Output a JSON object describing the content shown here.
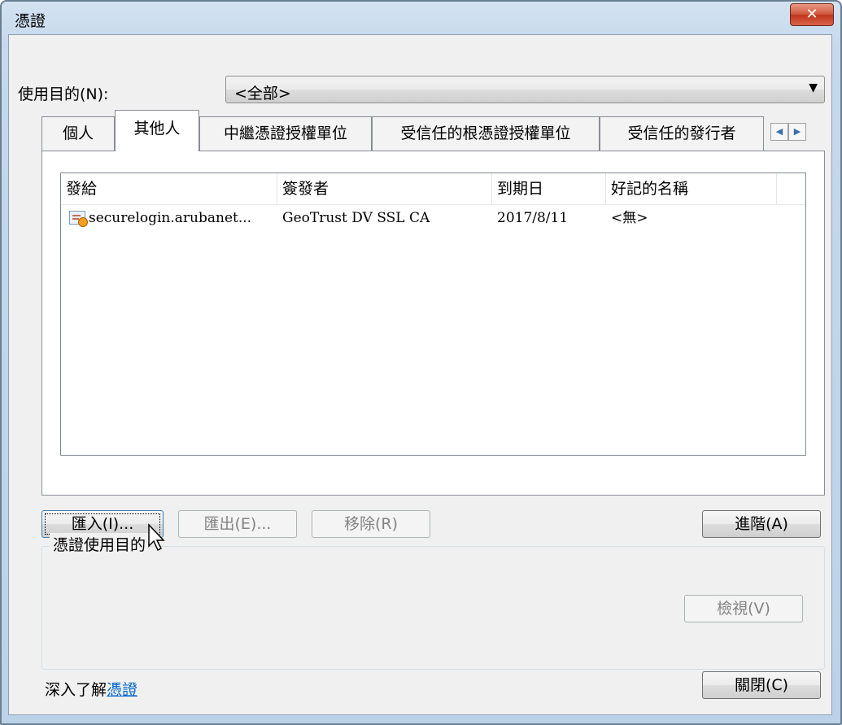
{
  "window": {
    "title": "憑證",
    "close_label": "✕"
  },
  "purpose": {
    "label": "使用目的(N):",
    "selected": "<全部>"
  },
  "tabs": [
    {
      "label": "個人",
      "active": false
    },
    {
      "label": "其他人",
      "active": true
    },
    {
      "label": "中繼憑證授權單位",
      "active": false
    },
    {
      "label": "受信任的根憑證授權單位",
      "active": false
    },
    {
      "label": "受信任的發行者",
      "active": false
    }
  ],
  "list": {
    "columns": [
      "發給",
      "簽發者",
      "到期日",
      "好記的名稱"
    ],
    "rows": [
      {
        "issued_to": "securelogin.arubanet...",
        "issued_by": "GeoTrust DV SSL CA",
        "expiration": "2017/8/11",
        "friendly_name": "<無>"
      }
    ]
  },
  "buttons": {
    "import": "匯入(I)...",
    "export": "匯出(E)...",
    "remove": "移除(R)",
    "advanced": "進階(A)",
    "view": "檢視(V)",
    "close": "關閉(C)"
  },
  "purposes_group": {
    "title": "憑證使用目的"
  },
  "learn_more": {
    "prefix": "深入了解",
    "link": "憑證"
  }
}
